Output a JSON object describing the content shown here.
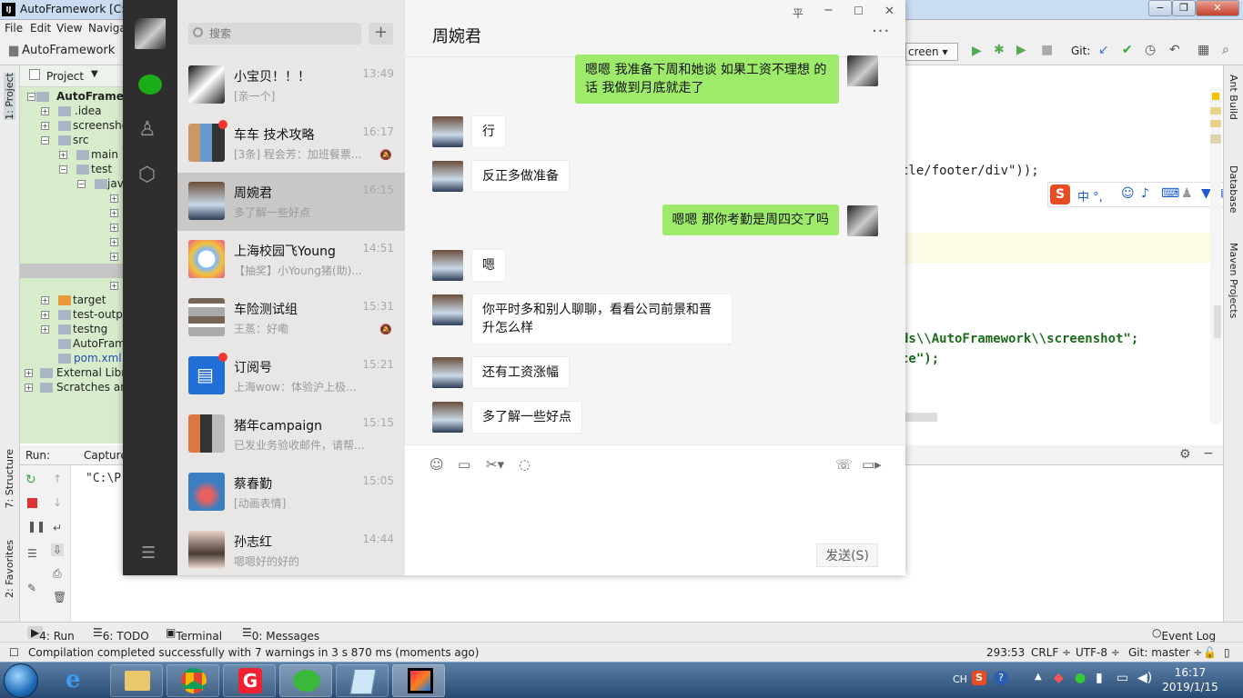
{
  "ide": {
    "title": "AutoFramework [C:",
    "menu": [
      "File",
      "Edit",
      "View",
      "Navigate"
    ],
    "project_crumb": "AutoFramework",
    "run_config": "creen",
    "git_label": "Git:",
    "project_tab_label": "Project",
    "tree": [
      {
        "label": "AutoFramew",
        "bold": true
      },
      {
        "label": ".idea"
      },
      {
        "label": "screensho"
      },
      {
        "label": "src"
      },
      {
        "label": "main"
      },
      {
        "label": "test"
      },
      {
        "label": "jav"
      },
      {
        "label": "target"
      },
      {
        "label": "test-outpu"
      },
      {
        "label": "testng"
      },
      {
        "label": "AutoFram"
      },
      {
        "label": "pom.xml"
      },
      {
        "label": "External Libra"
      },
      {
        "label": "Scratches and"
      }
    ],
    "code_lines": [
      "cle/footer/div\"));",
      "ds\\\\AutoFramework\\\\screenshot\";",
      "ce\");"
    ],
    "run_label": "Run:",
    "run_tab": "Capture",
    "run_output": "\"C:\\P",
    "left_stripe": [
      "1: Project",
      "7: Structure",
      "2: Favorites"
    ],
    "right_stripe": [
      "Ant Build",
      "Database",
      "Maven Projects"
    ],
    "bottom_tabs": [
      "4: Run",
      "6: TODO",
      "Terminal",
      "0: Messages",
      "Event Log"
    ],
    "status_message": "Compilation completed successfully with 7 warnings in 3 s 870 ms (moments ago)",
    "status_right": [
      "293:53",
      "CRLF ÷",
      "UTF-8 ÷",
      "Git: master ÷"
    ],
    "ime_text": "中 °,"
  },
  "wechat": {
    "search_placeholder": "搜索",
    "add_label": "+",
    "chat_title": "周婉君",
    "more_label": "···",
    "window_controls": [
      "平",
      "−",
      "☐",
      "✕"
    ],
    "send_label": "发送(S)",
    "conversations": [
      {
        "name": "小宝贝！！！",
        "time": "13:49",
        "preview": "[亲一个]",
        "badge": false,
        "muted": false
      },
      {
        "name": "车车 技术攻略",
        "time": "16:17",
        "preview": "[3条] 程会芳：加班餐票...",
        "badge": true,
        "muted": true
      },
      {
        "name": "周婉君",
        "time": "16:15",
        "preview": "多了解一些好点",
        "badge": false,
        "muted": false,
        "active": true
      },
      {
        "name": "上海校园飞Young",
        "time": "14:51",
        "preview": "【抽奖】小Young猪(助)...",
        "badge": false,
        "muted": false
      },
      {
        "name": "车险测试组",
        "time": "15:31",
        "preview": "王蒸：好嘞",
        "badge": false,
        "muted": true
      },
      {
        "name": "订阅号",
        "time": "15:21",
        "preview": "上海wow：体验沪上极...",
        "badge": true,
        "muted": false
      },
      {
        "name": "猪年campaign",
        "time": "15:15",
        "preview": "已发业务验收邮件，请帮...",
        "badge": false,
        "muted": false
      },
      {
        "name": "蔡春勤",
        "time": "15:05",
        "preview": "[动画表情]",
        "badge": false,
        "muted": false
      },
      {
        "name": "孙志红",
        "time": "14:44",
        "preview": "嗯嗯好的好的",
        "badge": false,
        "muted": false
      }
    ],
    "messages": [
      {
        "dir": "out",
        "text": "嗯嗯 我准备下周和她谈  如果工资不理想 的话 我做到月底就走了"
      },
      {
        "dir": "in",
        "text": "行"
      },
      {
        "dir": "in",
        "text": "反正多做准备"
      },
      {
        "dir": "out",
        "text": "嗯嗯  那你考勤是周四交了吗"
      },
      {
        "dir": "in",
        "text": "嗯"
      },
      {
        "dir": "in",
        "text": "你平时多和别人聊聊，看看公司前景和晋升怎么样"
      },
      {
        "dir": "in",
        "text": "还有工资涨幅"
      },
      {
        "dir": "in",
        "text": "多了解一些好点"
      }
    ]
  },
  "taskbar": {
    "time": "16:17",
    "date": "2019/1/15",
    "lang": "CH"
  },
  "colors": {
    "wechat_green": "#9eea6a",
    "nav_dark": "#2e2e2e",
    "badge_red": "#f43530",
    "project_green": "#d7ecca"
  }
}
